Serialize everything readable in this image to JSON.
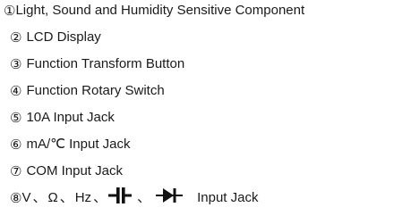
{
  "legend": {
    "items": [
      {
        "number": "①",
        "label": "Light, Sound and Humidity Sensitive Component"
      },
      {
        "number": "②",
        "label": "LCD Display"
      },
      {
        "number": "③",
        "label": "Function Transform Button"
      },
      {
        "number": "④",
        "label": "Function Rotary Switch"
      },
      {
        "number": "⑤",
        "label": "10A Input Jack"
      },
      {
        "number": "⑥",
        "label": "mA/℃ Input Jack"
      },
      {
        "number": "⑦",
        "label": "COM Input Jack"
      }
    ],
    "last_item": {
      "number": "⑧",
      "symbols": [
        "V",
        "Ω",
        "Hz"
      ],
      "separator": "、",
      "icons": [
        "capacitor-icon",
        "diode-icon"
      ],
      "label": "Input Jack"
    }
  }
}
